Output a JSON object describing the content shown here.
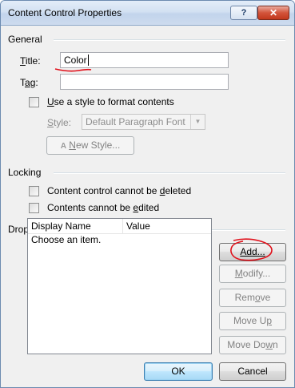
{
  "window": {
    "title": "Content Control Properties",
    "help_label": "?",
    "close_label": "✕"
  },
  "general": {
    "group_label": "General",
    "title_label": "Title:",
    "title_value": "Color",
    "tag_label": "Tag:",
    "tag_value": "",
    "use_style_label": "Use a style to format contents",
    "use_style_checked": false,
    "style_label": "Style:",
    "style_value": "Default Paragraph Font",
    "new_style_label": "New Style..."
  },
  "locking": {
    "group_label": "Locking",
    "cannot_delete_label": "Content control cannot be deleted",
    "cannot_delete_checked": false,
    "cannot_edit_label": "Contents cannot be edited",
    "cannot_edit_checked": false
  },
  "dropdown": {
    "group_label": "Drop-Down List Properties",
    "columns": [
      "Display Name",
      "Value"
    ],
    "rows": [
      {
        "display_name": "Choose an item.",
        "value": ""
      }
    ],
    "buttons": {
      "add": "Add...",
      "modify": "Modify...",
      "remove": "Remove",
      "move_up": "Move Up",
      "move_down": "Move Down"
    }
  },
  "footer": {
    "ok": "OK",
    "cancel": "Cancel"
  },
  "annotations": {
    "color": "#e0101a"
  }
}
